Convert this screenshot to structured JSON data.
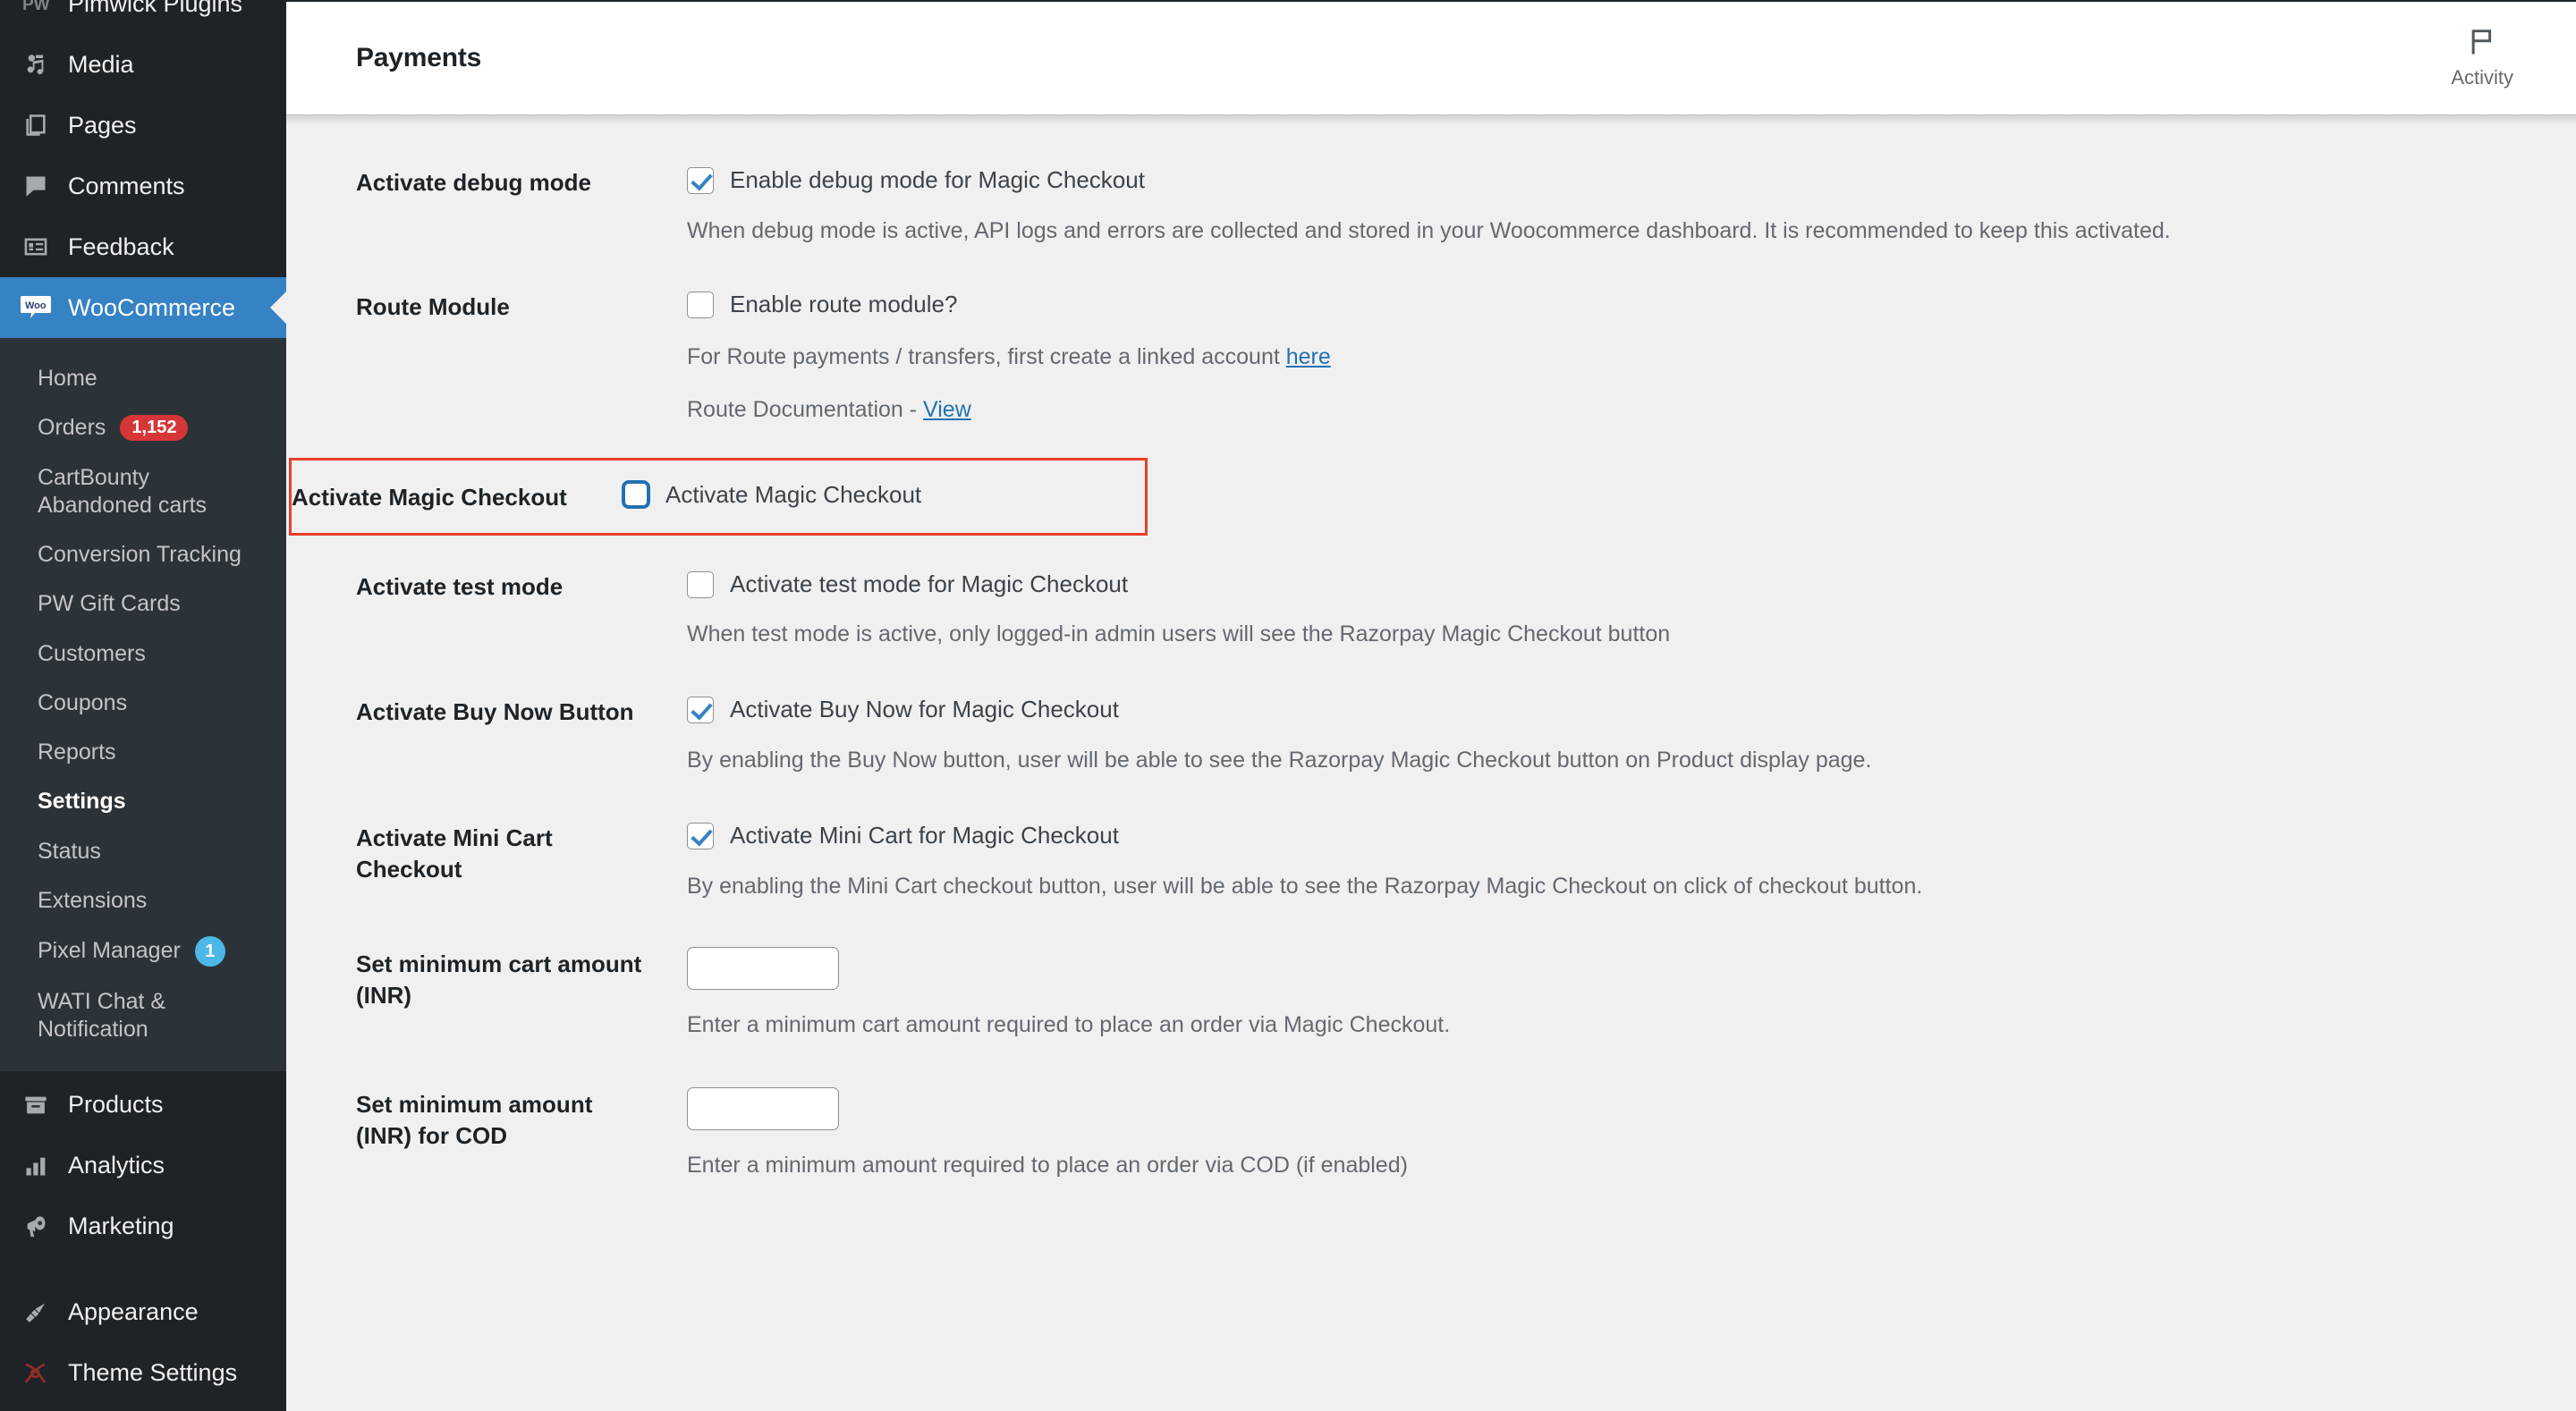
{
  "sidebar": {
    "top_items": [
      {
        "label": "Pimwick Plugins",
        "icon": "pw-icon"
      },
      {
        "label": "Media",
        "icon": "media-icon"
      },
      {
        "label": "Pages",
        "icon": "pages-icon"
      },
      {
        "label": "Comments",
        "icon": "comments-icon"
      },
      {
        "label": "Feedback",
        "icon": "feedback-icon"
      }
    ],
    "active_item": {
      "label": "WooCommerce",
      "icon": "woocommerce-icon"
    },
    "submenu": [
      {
        "label": "Home",
        "badge": "",
        "badge_type": "",
        "current": false
      },
      {
        "label": "Orders",
        "badge": "1,152",
        "badge_type": "red",
        "current": false
      },
      {
        "label": "CartBounty\nAbandoned carts",
        "badge": "",
        "badge_type": "",
        "current": false
      },
      {
        "label": "Conversion Tracking",
        "badge": "",
        "badge_type": "",
        "current": false
      },
      {
        "label": "PW Gift Cards",
        "badge": "",
        "badge_type": "",
        "current": false
      },
      {
        "label": "Customers",
        "badge": "",
        "badge_type": "",
        "current": false
      },
      {
        "label": "Coupons",
        "badge": "",
        "badge_type": "",
        "current": false
      },
      {
        "label": "Reports",
        "badge": "",
        "badge_type": "",
        "current": false
      },
      {
        "label": "Settings",
        "badge": "",
        "badge_type": "",
        "current": true
      },
      {
        "label": "Status",
        "badge": "",
        "badge_type": "",
        "current": false
      },
      {
        "label": "Extensions",
        "badge": "",
        "badge_type": "",
        "current": false
      },
      {
        "label": "Pixel Manager",
        "badge": "1",
        "badge_type": "blue",
        "current": false
      },
      {
        "label": "WATI Chat &\nNotification",
        "badge": "",
        "badge_type": "",
        "current": false
      }
    ],
    "bottom_items": [
      {
        "label": "Products",
        "icon": "products-icon"
      },
      {
        "label": "Analytics",
        "icon": "analytics-icon"
      },
      {
        "label": "Marketing",
        "icon": "marketing-icon"
      }
    ],
    "tail_items": [
      {
        "label": "Appearance",
        "icon": "appearance-icon"
      },
      {
        "label": "Theme Settings",
        "icon": "theme-settings-icon"
      }
    ]
  },
  "header": {
    "title": "Payments",
    "activity_label": "Activity",
    "activity_icon": "flag-icon"
  },
  "settings": {
    "debug": {
      "label": "Activate debug mode",
      "checkbox_label": "Enable debug mode for Magic Checkout",
      "checked": true,
      "description": "When debug mode is active, API logs and errors are collected and stored in your Woocommerce dashboard. It is recommended to keep this activated."
    },
    "route": {
      "label": "Route Module",
      "checkbox_label": "Enable route module?",
      "checked": false,
      "desc_prefix": "For Route payments / transfers, first create a linked account ",
      "desc_link": "here",
      "doc_prefix": "Route Documentation - ",
      "doc_link": "View"
    },
    "magic_checkout": {
      "label": "Activate Magic Checkout",
      "checkbox_label": "Activate Magic Checkout",
      "checked": false,
      "highlight_color": "#e8402a"
    },
    "test_mode": {
      "label": "Activate test mode",
      "checkbox_label": "Activate test mode for Magic Checkout",
      "checked": false,
      "description": "When test mode is active, only logged-in admin users will see the Razorpay Magic Checkout button"
    },
    "buy_now": {
      "label": "Activate Buy Now Button",
      "checkbox_label": "Activate Buy Now for Magic Checkout",
      "checked": true,
      "description": "By enabling the Buy Now button, user will be able to see the Razorpay Magic Checkout button on Product display page."
    },
    "mini_cart": {
      "label": "Activate Mini Cart Checkout",
      "checkbox_label": "Activate Mini Cart for Magic Checkout",
      "checked": true,
      "description": "By enabling the Mini Cart checkout button, user will be able to see the Razorpay Magic Checkout on click of checkout button."
    },
    "min_cart_amount": {
      "label": "Set minimum cart amount (INR)",
      "value": "",
      "description": "Enter a minimum cart amount required to place an order via Magic Checkout."
    },
    "min_cod_amount": {
      "label": "Set minimum amount (INR) for COD",
      "value": "",
      "description": "Enter a minimum amount required to place an order via COD (if enabled)"
    }
  }
}
